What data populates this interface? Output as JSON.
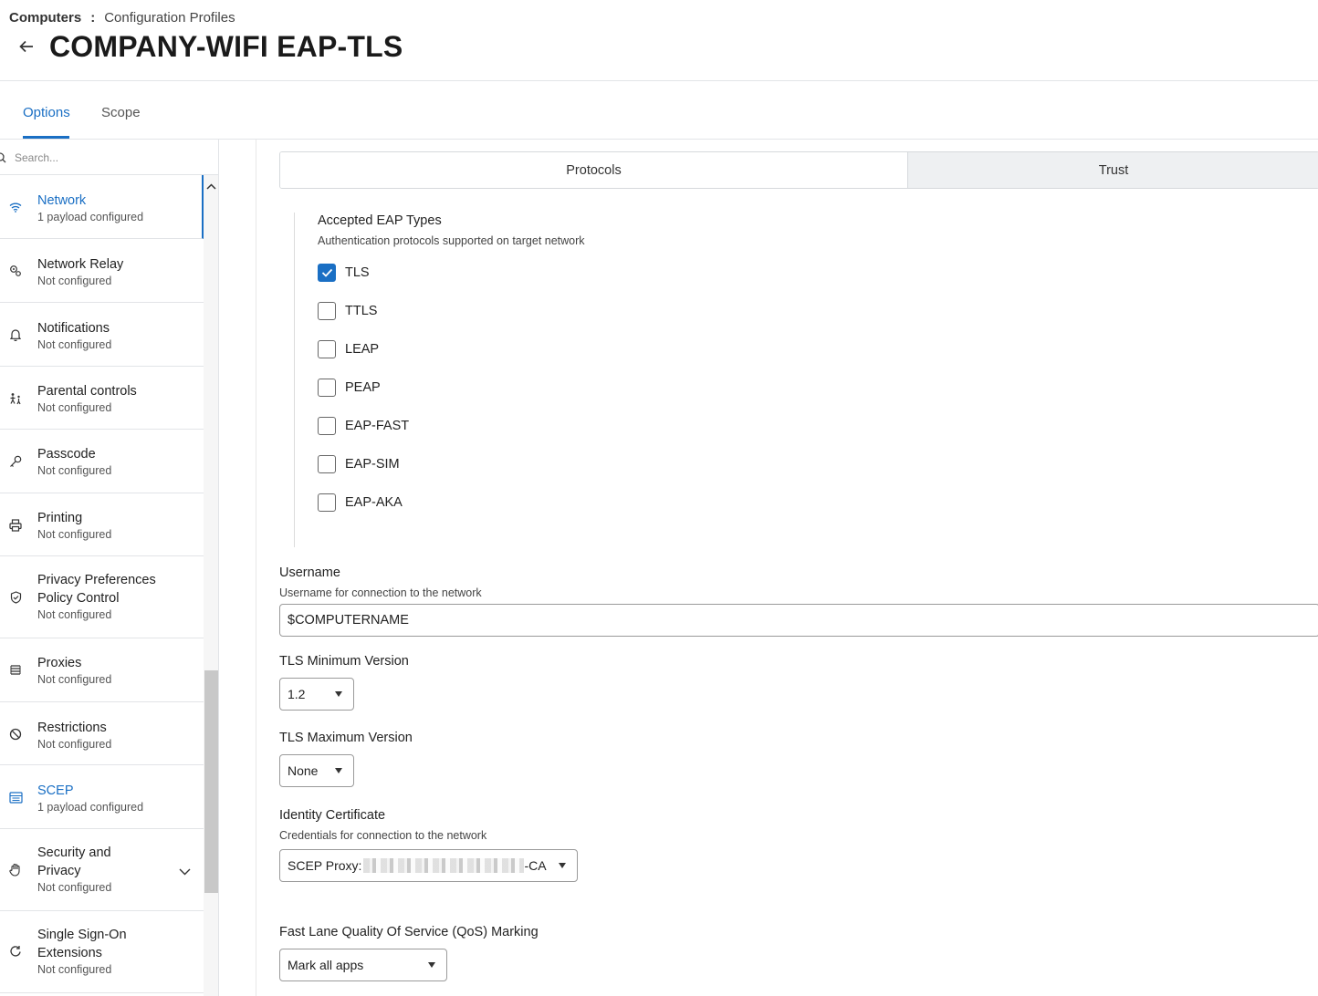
{
  "breadcrumb": {
    "root": "Computers",
    "separator": ":",
    "current": "Configuration Profiles"
  },
  "page_title": "COMPANY-WIFI EAP-TLS",
  "tabs": [
    {
      "label": "Options"
    },
    {
      "label": "Scope"
    }
  ],
  "sidebar": {
    "search_placeholder": "Search...",
    "items": [
      {
        "label": "Network",
        "status": "1 payload configured",
        "icon": "wifi-icon"
      },
      {
        "label": "Network Relay",
        "status": "Not configured",
        "icon": "relay-icon"
      },
      {
        "label": "Notifications",
        "status": "Not configured",
        "icon": "bell-icon"
      },
      {
        "label": "Parental controls",
        "status": "Not configured",
        "icon": "family-icon"
      },
      {
        "label": "Passcode",
        "status": "Not configured",
        "icon": "key-icon"
      },
      {
        "label": "Printing",
        "status": "Not configured",
        "icon": "printer-icon"
      },
      {
        "label": "Privacy Preferences Policy Control",
        "status": "Not configured",
        "icon": "shield-icon"
      },
      {
        "label": "Proxies",
        "status": "Not configured",
        "icon": "proxy-icon"
      },
      {
        "label": "Restrictions",
        "status": "Not configured",
        "icon": "restricted-icon"
      },
      {
        "label": "SCEP",
        "status": "1 payload configured",
        "icon": "certificate-icon"
      },
      {
        "label": "Security and Privacy",
        "status": "Not configured",
        "icon": "hand-icon"
      },
      {
        "label": "Single Sign-On Extensions",
        "status": "Not configured",
        "icon": "sso-icon"
      }
    ]
  },
  "segments": [
    {
      "label": "Protocols"
    },
    {
      "label": "Trust"
    }
  ],
  "eap": {
    "title": "Accepted EAP Types",
    "description": "Authentication protocols supported on target network",
    "options": [
      {
        "label": "TLS",
        "checked": true
      },
      {
        "label": "TTLS",
        "checked": false
      },
      {
        "label": "LEAP",
        "checked": false
      },
      {
        "label": "PEAP",
        "checked": false
      },
      {
        "label": "EAP-FAST",
        "checked": false
      },
      {
        "label": "EAP-SIM",
        "checked": false
      },
      {
        "label": "EAP-AKA",
        "checked": false
      }
    ]
  },
  "username": {
    "title": "Username",
    "description": "Username for connection to the network",
    "value": "$COMPUTERNAME"
  },
  "tls_min": {
    "title": "TLS Minimum Version",
    "value": "1.2"
  },
  "tls_max": {
    "title": "TLS Maximum Version",
    "value": "None"
  },
  "identity": {
    "title": "Identity Certificate",
    "description": "Credentials for connection to the network",
    "value_prefix": "SCEP Proxy:",
    "value_suffix": "-CA"
  },
  "qos": {
    "title": "Fast Lane Quality Of Service (QoS) Marking",
    "value": "Mark all apps"
  },
  "colors": {
    "accent": "#1a6fc4",
    "border": "#e2e4e7"
  }
}
